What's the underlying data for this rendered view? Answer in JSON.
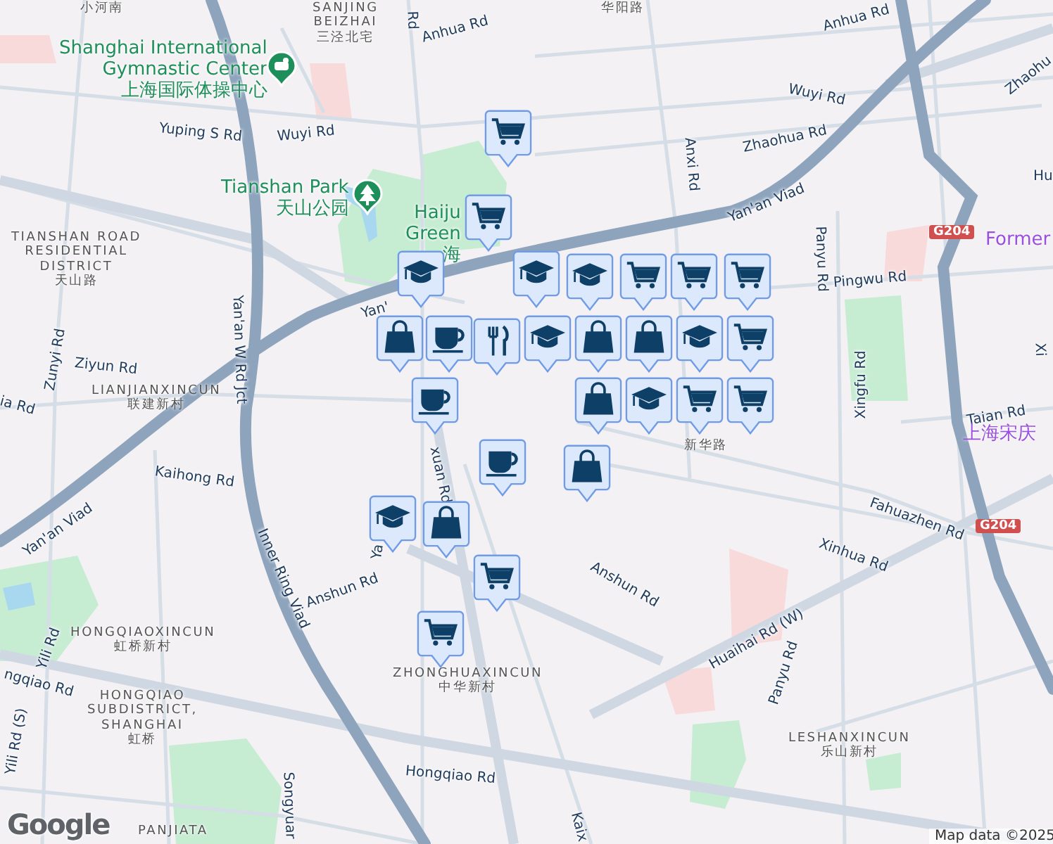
{
  "map": {
    "labels": [
      {
        "kind": "area",
        "lines": [
          "小河南"
        ]
      },
      {
        "kind": "area",
        "lines": [
          "SANJING",
          "BEIZHAI",
          "三泾北宅"
        ]
      },
      {
        "kind": "road",
        "lines": [
          "Rd"
        ]
      },
      {
        "kind": "road",
        "lines": [
          "Anhua Rd"
        ]
      },
      {
        "kind": "area",
        "lines": [
          "华阳路"
        ]
      },
      {
        "kind": "road",
        "lines": [
          "Anhua Rd"
        ]
      },
      {
        "kind": "poi",
        "lines": [
          "Shanghai International",
          "Gymnastic Center",
          "上海国际体操中心"
        ]
      },
      {
        "kind": "road",
        "lines": [
          "Yuping S Rd"
        ]
      },
      {
        "kind": "road",
        "lines": [
          "Wuyi Rd"
        ]
      },
      {
        "kind": "road",
        "lines": [
          "Wuyi Rd"
        ]
      },
      {
        "kind": "road",
        "lines": [
          "Zhaohua Rd"
        ]
      },
      {
        "kind": "road",
        "lines": [
          "Zhaohu"
        ]
      },
      {
        "kind": "road",
        "lines": [
          "Anxi Rd"
        ]
      },
      {
        "kind": "poi",
        "lines": [
          "Tianshan Park",
          "天山公园"
        ]
      },
      {
        "kind": "poi",
        "lines": [
          "Haiju",
          "Green",
          "海"
        ]
      },
      {
        "kind": "area",
        "lines": [
          "TIANSHAN ROAD",
          "RESIDENTIAL",
          "DISTRICT",
          "天山路"
        ]
      },
      {
        "kind": "road",
        "lines": [
          "Yan'an Viad"
        ]
      },
      {
        "kind": "road",
        "lines": [
          "Yan'"
        ]
      },
      {
        "kind": "road",
        "lines": [
          "Hu"
        ]
      },
      {
        "kind": "shield",
        "lines": [
          "G204"
        ]
      },
      {
        "kind": "place",
        "lines": [
          "Former"
        ]
      },
      {
        "kind": "road",
        "lines": [
          "Panyu Rd"
        ]
      },
      {
        "kind": "road",
        "lines": [
          "Pingwu Rd"
        ]
      },
      {
        "kind": "road",
        "lines": [
          "Yan'an W Rd Jct"
        ]
      },
      {
        "kind": "road",
        "lines": [
          "Zunyi Rd"
        ]
      },
      {
        "kind": "road",
        "lines": [
          "Ziyun Rd"
        ]
      },
      {
        "kind": "area",
        "lines": [
          "LIANJIANXINCUN",
          "联建新村"
        ]
      },
      {
        "kind": "road",
        "lines": [
          "ia Rd"
        ]
      },
      {
        "kind": "road",
        "lines": [
          "Xingfu Rd"
        ]
      },
      {
        "kind": "road",
        "lines": [
          "Xi"
        ]
      },
      {
        "kind": "road",
        "lines": [
          "Taian Rd"
        ]
      },
      {
        "kind": "place",
        "lines": [
          "上海宋庆"
        ]
      },
      {
        "kind": "area",
        "lines": [
          "新华路"
        ]
      },
      {
        "kind": "road",
        "lines": [
          "Kaihong Rd"
        ]
      },
      {
        "kind": "road",
        "lines": [
          "Yan'an Viad"
        ]
      },
      {
        "kind": "road",
        "lines": [
          "Inner Ring Viad"
        ]
      },
      {
        "kind": "road",
        "lines": [
          "Anshun Rd"
        ]
      },
      {
        "kind": "road",
        "lines": [
          "Anshun Rd"
        ]
      },
      {
        "kind": "road",
        "lines": [
          "xuan Rd"
        ]
      },
      {
        "kind": "road",
        "lines": [
          "Ya"
        ]
      },
      {
        "kind": "road",
        "lines": [
          "Fahuazhen Rd"
        ]
      },
      {
        "kind": "shield",
        "lines": [
          "G204"
        ]
      },
      {
        "kind": "road",
        "lines": [
          "Xinhua Rd"
        ]
      },
      {
        "kind": "road",
        "lines": [
          "Huaihai Rd (W)"
        ]
      },
      {
        "kind": "road",
        "lines": [
          "Panyu Rd"
        ]
      },
      {
        "kind": "area",
        "lines": [
          "HONGQIAOXINCUN",
          "虹桥新村"
        ]
      },
      {
        "kind": "road",
        "lines": [
          "Yili Rd"
        ]
      },
      {
        "kind": "road",
        "lines": [
          "ngqiao Rd"
        ]
      },
      {
        "kind": "area",
        "lines": [
          "HONGQIAO",
          "SUBDISTRICT,",
          "SHANGHAI",
          "虹桥"
        ]
      },
      {
        "kind": "area",
        "lines": [
          "ZHONGHUAXINCUN",
          "中华新村"
        ]
      },
      {
        "kind": "road",
        "lines": [
          "Hongqiao Rd"
        ]
      },
      {
        "kind": "road",
        "lines": [
          "Songyuar"
        ]
      },
      {
        "kind": "road",
        "lines": [
          "Yili Rd (S)"
        ]
      },
      {
        "kind": "area",
        "lines": [
          "LESHANXINCUN",
          "乐山新村"
        ]
      },
      {
        "kind": "road",
        "lines": [
          "Kaix"
        ]
      },
      {
        "kind": "logo",
        "lines": [
          "Google"
        ]
      },
      {
        "kind": "area",
        "lines": [
          "PANJIATA"
        ]
      },
      {
        "kind": "attribution",
        "lines": [
          "Map data ©2025"
        ]
      }
    ],
    "markers": [
      {
        "kind": "cart"
      },
      {
        "kind": "cart"
      },
      {
        "kind": "cap"
      },
      {
        "kind": "cap"
      },
      {
        "kind": "bag"
      },
      {
        "kind": "cup"
      },
      {
        "kind": "cup"
      },
      {
        "kind": "fork"
      },
      {
        "kind": "cap"
      },
      {
        "kind": "cart"
      },
      {
        "kind": "cart"
      },
      {
        "kind": "cart"
      },
      {
        "kind": "cart"
      },
      {
        "kind": "cap"
      },
      {
        "kind": "bag"
      },
      {
        "kind": "bag"
      },
      {
        "kind": "cap"
      },
      {
        "kind": "cart"
      },
      {
        "kind": "cart"
      },
      {
        "kind": "bag"
      },
      {
        "kind": "cap"
      },
      {
        "kind": "bag"
      },
      {
        "kind": "cup"
      },
      {
        "kind": "bag"
      },
      {
        "kind": "cap"
      },
      {
        "kind": "cart"
      },
      {
        "kind": "cart"
      }
    ]
  }
}
